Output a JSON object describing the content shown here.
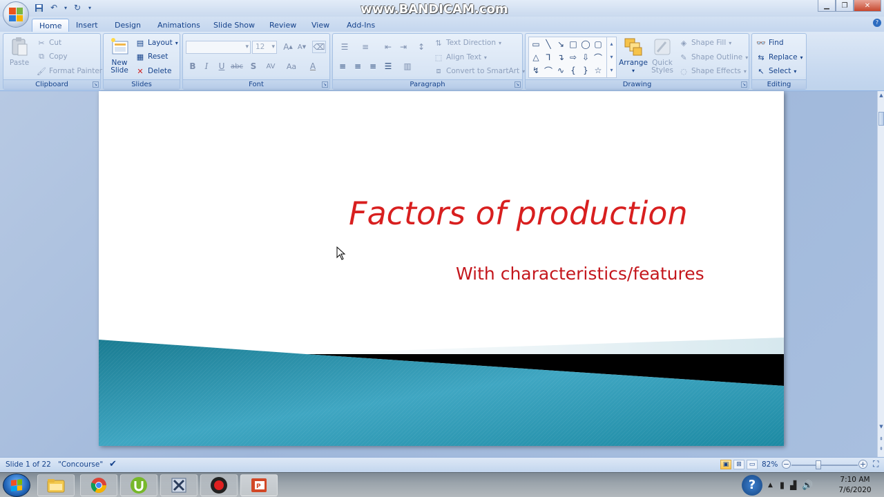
{
  "watermark": "www.BANDICAM.com",
  "tabs": [
    "Home",
    "Insert",
    "Design",
    "Animations",
    "Slide Show",
    "Review",
    "View",
    "Add-Ins"
  ],
  "ribbon": {
    "clipboard": {
      "label": "Clipboard",
      "paste": "Paste",
      "cut": "Cut",
      "copy": "Copy",
      "format_painter": "Format Painter"
    },
    "slides": {
      "label": "Slides",
      "new_slide_line1": "New",
      "new_slide_line2": "Slide",
      "layout": "Layout",
      "reset": "Reset",
      "delete": "Delete"
    },
    "font": {
      "label": "Font",
      "font_name": "",
      "font_size": "12",
      "bold": "B",
      "italic": "I",
      "underline": "U",
      "strike": "abc",
      "shadow": "S",
      "spacing": "AV",
      "case": "Aa",
      "color": "A"
    },
    "paragraph": {
      "label": "Paragraph",
      "text_direction": "Text Direction",
      "align_text": "Align Text",
      "convert_smartart": "Convert to SmartArt"
    },
    "drawing": {
      "label": "Drawing",
      "arrange": "Arrange",
      "quick_styles_line1": "Quick",
      "quick_styles_line2": "Styles",
      "shape_fill": "Shape Fill",
      "shape_outline": "Shape Outline",
      "shape_effects": "Shape Effects"
    },
    "editing": {
      "label": "Editing",
      "find": "Find",
      "replace": "Replace",
      "select": "Select"
    }
  },
  "slide": {
    "title": "Factors of production",
    "subtitle": "With characteristics/features",
    "title_color": "#d81f1f",
    "subtitle_color": "#c4171d"
  },
  "status": {
    "slide_info": "Slide 1 of 22",
    "theme": "\"Concourse\"",
    "zoom": "82%",
    "zoom_level": 0.82
  },
  "clock": {
    "time": "7:10 AM",
    "date": "7/6/2020"
  },
  "taskbar_apps": [
    "explorer-icon",
    "chrome-icon",
    "utorrent-icon",
    "tool-icon",
    "bandicam-icon",
    "powerpoint-icon"
  ]
}
